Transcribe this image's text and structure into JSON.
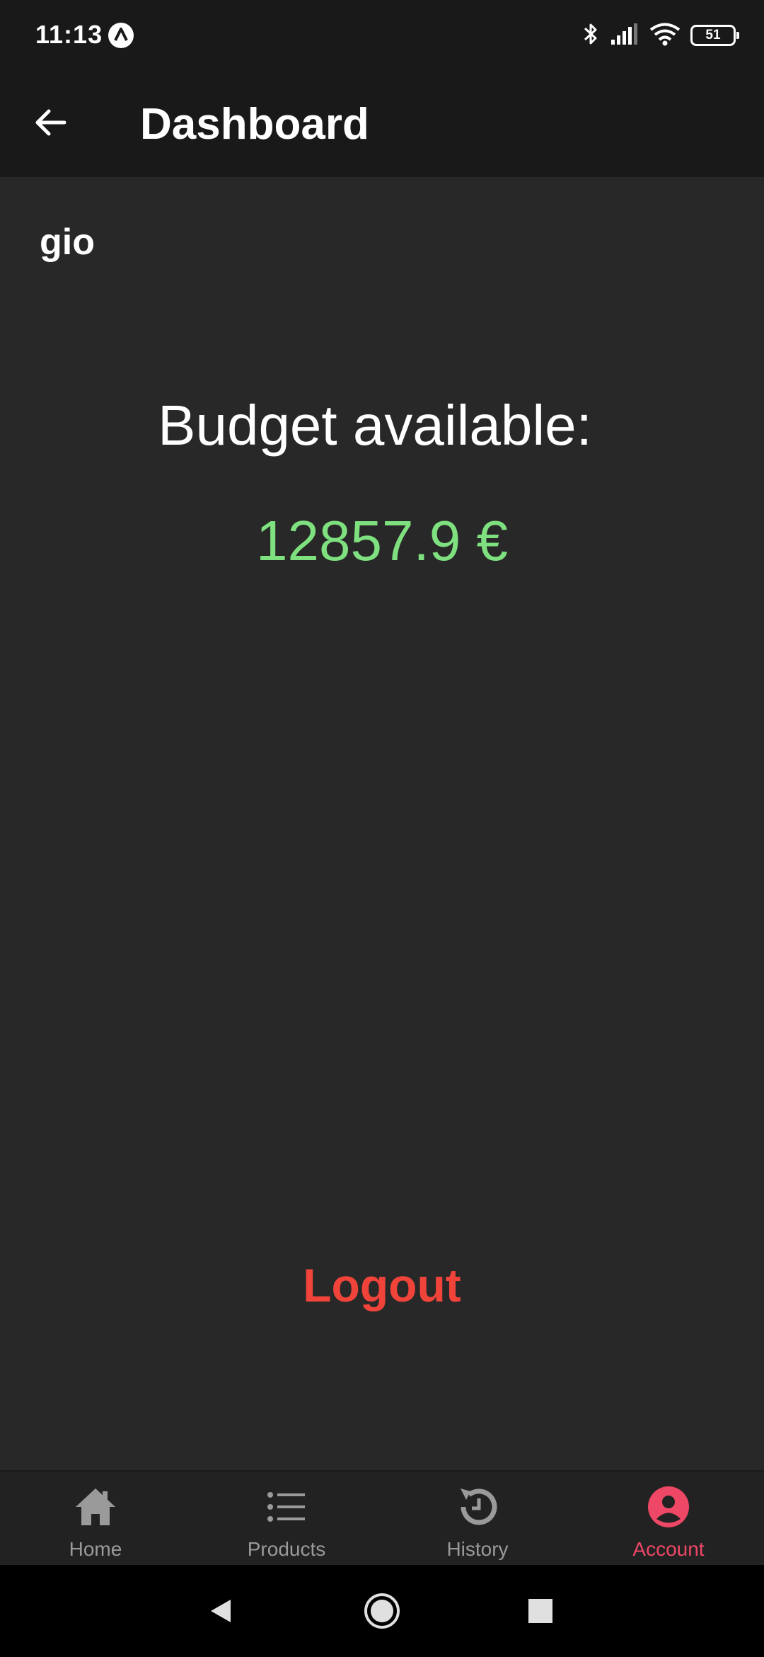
{
  "status_bar": {
    "time": "11:13",
    "battery": "51",
    "icons": [
      "app-notification-icon",
      "bluetooth-icon",
      "signal-icon",
      "wifi-icon",
      "battery-icon"
    ]
  },
  "app_bar": {
    "title": "Dashboard",
    "back_icon": "arrow-left-icon"
  },
  "content": {
    "username": "gio",
    "budget_label": "Budget available:",
    "budget_value": "12857.9 €",
    "logout_label": "Logout"
  },
  "bottom_nav": {
    "items": [
      {
        "label": "Home",
        "icon": "home-icon",
        "active": false
      },
      {
        "label": "Products",
        "icon": "list-icon",
        "active": false
      },
      {
        "label": "History",
        "icon": "history-icon",
        "active": false
      },
      {
        "label": "Account",
        "icon": "account-icon",
        "active": true
      }
    ]
  },
  "colors": {
    "background": "#282828",
    "bar": "#191919",
    "budget_value": "#7ee07e",
    "logout": "#f0443a",
    "active_nav": "#ef4766",
    "inactive_nav": "#9a9a9a"
  }
}
